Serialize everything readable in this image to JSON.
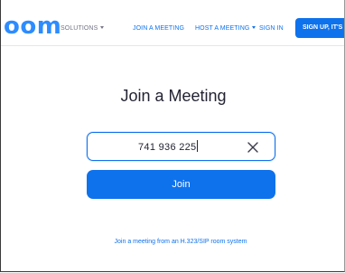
{
  "header": {
    "logo_text": "oom",
    "nav": {
      "solutions_label": "SOLUTIONS",
      "join_label": "JOIN A MEETING",
      "host_label": "HOST A MEETING",
      "signin_label": "SIGN IN",
      "signup_label": "SIGN UP, IT'S"
    }
  },
  "main": {
    "title": "Join a Meeting",
    "meeting_id_value": "741 936 225",
    "join_label": "Join",
    "h323_link": "Join a meeting from an H.323/SIP room system"
  },
  "colors": {
    "brand": "#2d8cff",
    "accent": "#0e72ed",
    "text": "#232333",
    "nav_gray": "#747487"
  },
  "icons": {
    "clear": "close-icon",
    "dropdown": "chevron-down-icon"
  }
}
